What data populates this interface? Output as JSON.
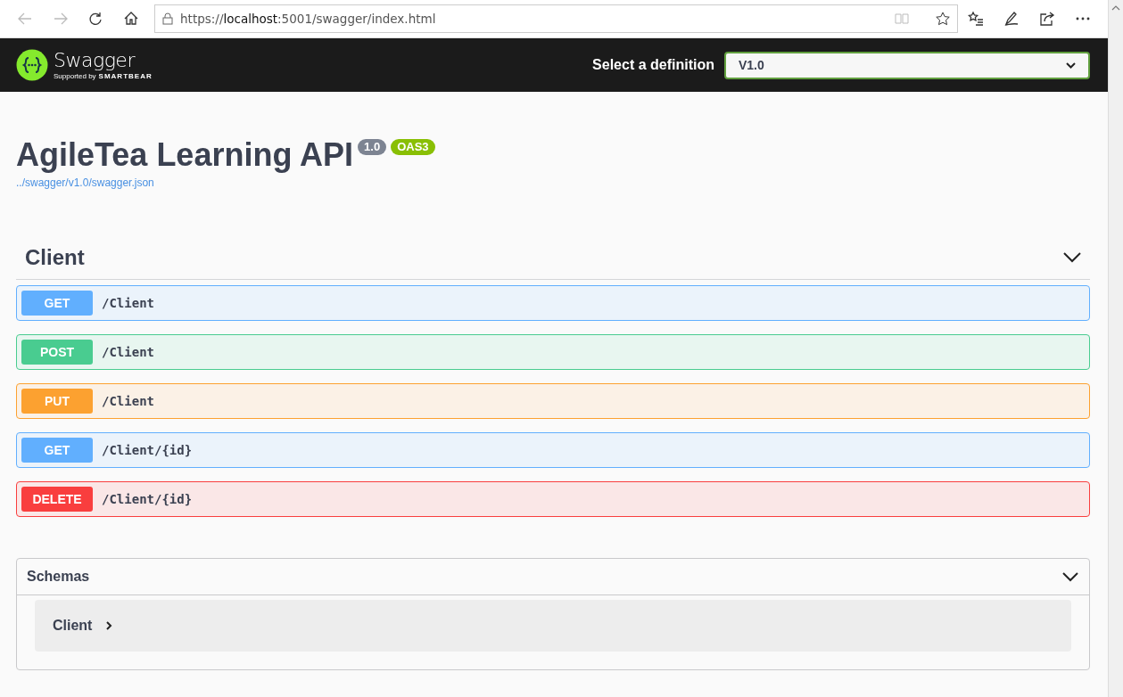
{
  "browser": {
    "url_prefix": "https://",
    "url_host": "localhost",
    "url_rest": ":5001/swagger/index.html"
  },
  "topbar": {
    "brand": "Swagger",
    "supported_by": "Supported by",
    "company": "SMARTBEAR",
    "definition_label": "Select a definition",
    "definition_value": "V1.0"
  },
  "info": {
    "title": "AgileTea Learning API",
    "version": "1.0",
    "spec_badge": "OAS3",
    "spec_url": "../swagger/v1.0/swagger.json"
  },
  "tag": {
    "name": "Client",
    "expanded": true,
    "operations": [
      {
        "kind": "get",
        "method": "GET",
        "path": "/Client"
      },
      {
        "kind": "post",
        "method": "POST",
        "path": "/Client"
      },
      {
        "kind": "put",
        "method": "PUT",
        "path": "/Client"
      },
      {
        "kind": "get",
        "method": "GET",
        "path": "/Client/{id}"
      },
      {
        "kind": "delete",
        "method": "DELETE",
        "path": "/Client/{id}"
      }
    ]
  },
  "schemas": {
    "title": "Schemas",
    "expanded": true,
    "items": [
      {
        "name": "Client",
        "expanded": false
      }
    ]
  }
}
